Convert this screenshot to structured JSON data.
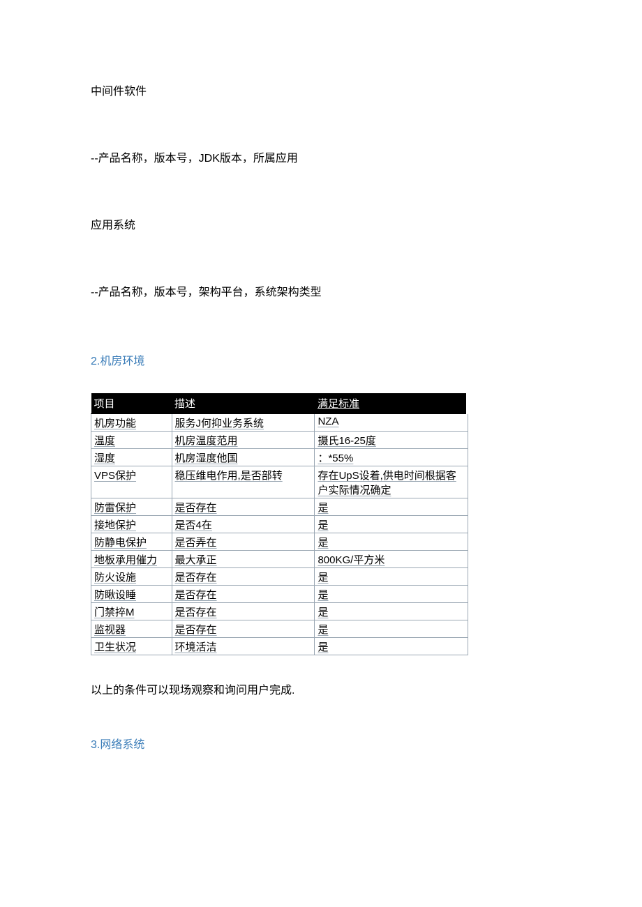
{
  "para1": "中间件软件",
  "para2": "--产品名称，版本号，JDK版本，所属应用",
  "para3": "应用系统",
  "para4": "--产品名称，版本号，架构平台，系统架构类型",
  "section2_heading": "2.机房环境",
  "table": {
    "headers": [
      "项目",
      "描述",
      "满足标准"
    ],
    "rows": [
      [
        "机房功能",
        "服务J何抑业务系统",
        "NZA"
      ],
      [
        "温度",
        "机房温度范用",
        "摄氏16-25度"
      ],
      [
        "湿度",
        "机房湿度他国",
        "：*55%"
      ],
      [
        "VPS保护",
        "稳压维电作用,是否部转",
        "存在UpS设着,供电时间根据客户实际情况确定"
      ],
      [
        "防雷保护",
        "是否存在",
        "是"
      ],
      [
        "接地保护",
        "是否4在",
        "是"
      ],
      [
        "防静电保护",
        "是否弄在",
        "是"
      ],
      [
        "地板承用催力",
        "最大承正",
        "800KG/平方米"
      ],
      [
        "防火设施",
        "是否存在",
        "是"
      ],
      [
        "防瞅设睡",
        "是否存在",
        "是"
      ],
      [
        "门禁捽M",
        "是否存在",
        "是"
      ],
      [
        "监视器",
        "是否存在",
        "是"
      ],
      [
        "卫生状况",
        "环境活洁",
        "是"
      ]
    ]
  },
  "note": "以上的条件可以现场观察和询问用户完成.",
  "section3_heading": "3.网络系统"
}
